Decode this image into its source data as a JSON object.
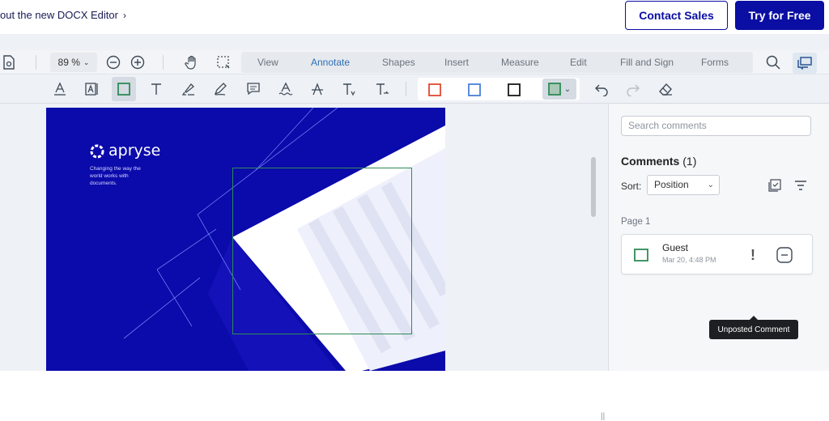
{
  "banner": {
    "promo_text": "out the new DOCX Editor",
    "contact_label": "Contact Sales",
    "try_label": "Try for Free"
  },
  "toolbar": {
    "zoom": "89 %",
    "tabs": [
      "View",
      "Annotate",
      "Shapes",
      "Insert",
      "Measure",
      "Edit",
      "Fill and Sign",
      "Forms"
    ],
    "active_tab": "Annotate",
    "tools": [
      "underline-tool",
      "free-text-box-tool",
      "rectangle-tool",
      "free-text-tool",
      "highlight-tool",
      "freehand-tool",
      "comment-tool",
      "squiggly-tool",
      "strikeout-tool",
      "text-insert-tool",
      "text-replace-tool"
    ],
    "color_presets": [
      "#e04a2f",
      "#4a7fd6",
      "#1a1a1a",
      "#2e8b57"
    ],
    "undo_icon": "undo-icon",
    "redo_icon": "redo-icon",
    "eraser_icon": "eraser-icon"
  },
  "document": {
    "logo_text": "apryse",
    "tagline_line1": "Changing the way the",
    "tagline_line2": "world works with",
    "tagline_line3": "documents.",
    "bg_color": "#0b0aab",
    "annotation_color": "#2e8b57"
  },
  "comments_panel": {
    "search_placeholder": "Search comments",
    "title": "Comments",
    "count": "(1)",
    "sort_label": "Sort:",
    "sort_value": "Position",
    "page_label": "Page 1",
    "comment": {
      "author": "Guest",
      "date": "Mar 20, 4:48 PM"
    },
    "tooltip": "Unposted Comment"
  }
}
